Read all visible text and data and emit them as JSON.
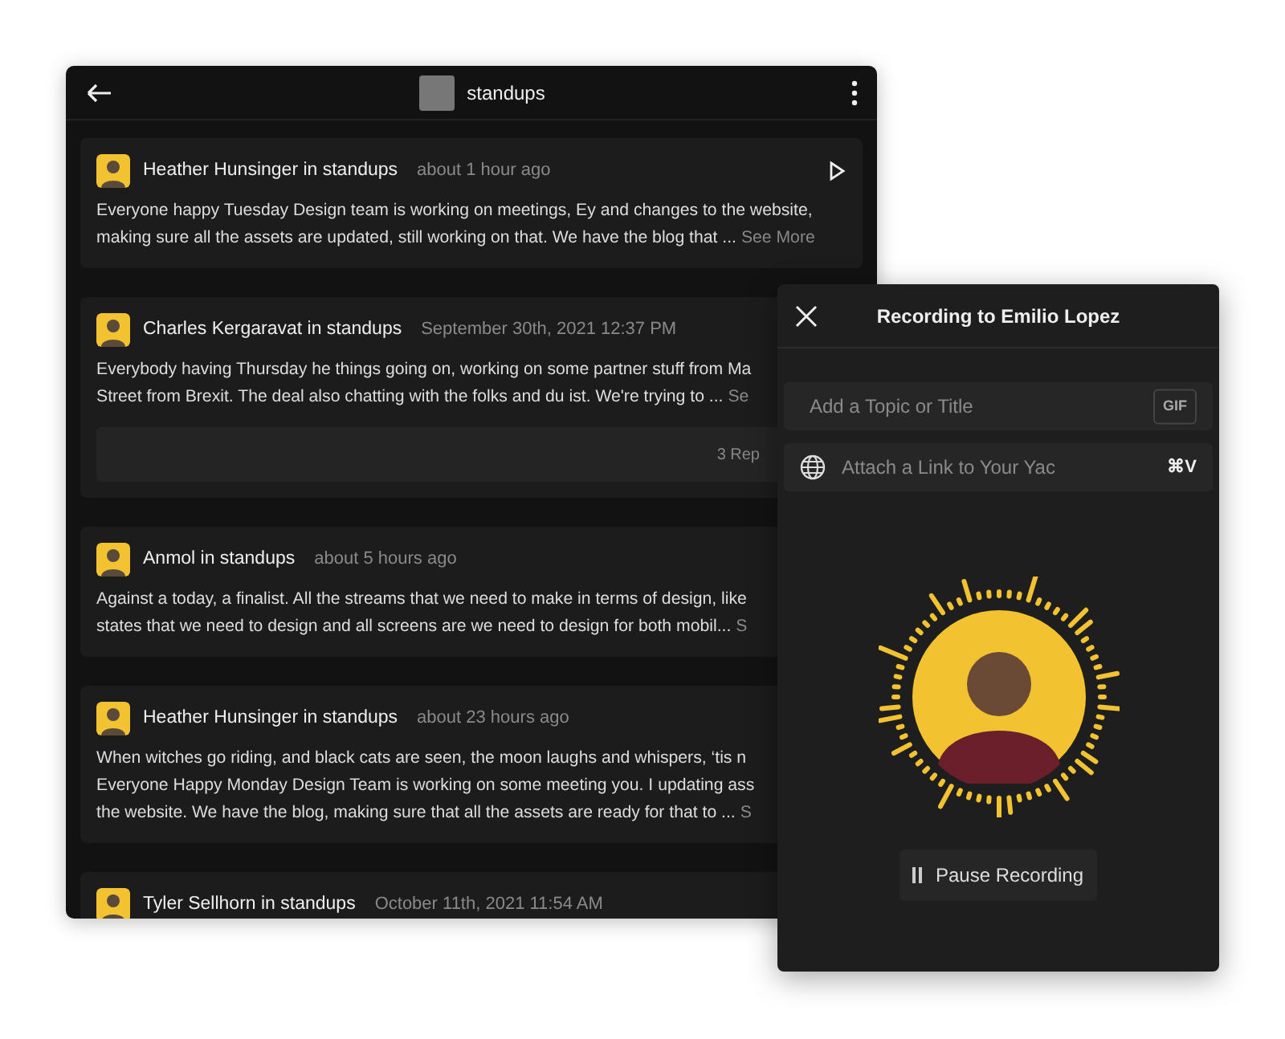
{
  "main_window": {
    "channel": "standups",
    "posts": [
      {
        "author": "Heather Hunsinger in standups",
        "time": "about 1 hour ago",
        "playable": true,
        "body_lines": [
          "Everyone happy Tuesday Design team is working on meetings, Ey and changes to the website,",
          "making sure all the assets are updated, still working on that. We have the blog that ..."
        ],
        "more": "See More"
      },
      {
        "author": "Charles Kergaravat in standups",
        "time": "September 30th, 2021 12:37 PM",
        "body_lines": [
          "Everybody having Thursday he things going on, working on some partner stuff from Ma",
          "Street from Brexit. The deal also chatting with the folks and du ist. We're trying to ..."
        ],
        "more": "Se",
        "replies": "3 Rep"
      },
      {
        "author": "Anmol in standups",
        "time": "about 5 hours ago",
        "body_lines": [
          "Against a today, a finalist. All the streams that we need to make in terms of design, like",
          "states that we need to design and all screens are we need to design for both mobil..."
        ],
        "more": "S"
      },
      {
        "author": "Heather Hunsinger in standups",
        "time": "about 23 hours ago",
        "body_lines": [
          "When witches go riding, and black cats are seen, the moon laughs and whispers, ‘tis n",
          "Everyone Happy Monday Design Team is working on some meeting you. I updating ass",
          "the website. We have the blog, making sure that all the assets are ready for that to ..."
        ],
        "more": "S"
      },
      {
        "author": "Tyler Sellhorn in standups",
        "time": "October 11th, 2021 11:54 AM"
      }
    ]
  },
  "recording_panel": {
    "title": "Recording to Emilio Lopez",
    "topic_placeholder": "Add a Topic or Title",
    "gif": "GIF",
    "link_placeholder": "Attach a Link to Your Yac",
    "shortcut": "⌘V",
    "pause_button": "Pause Recording"
  }
}
